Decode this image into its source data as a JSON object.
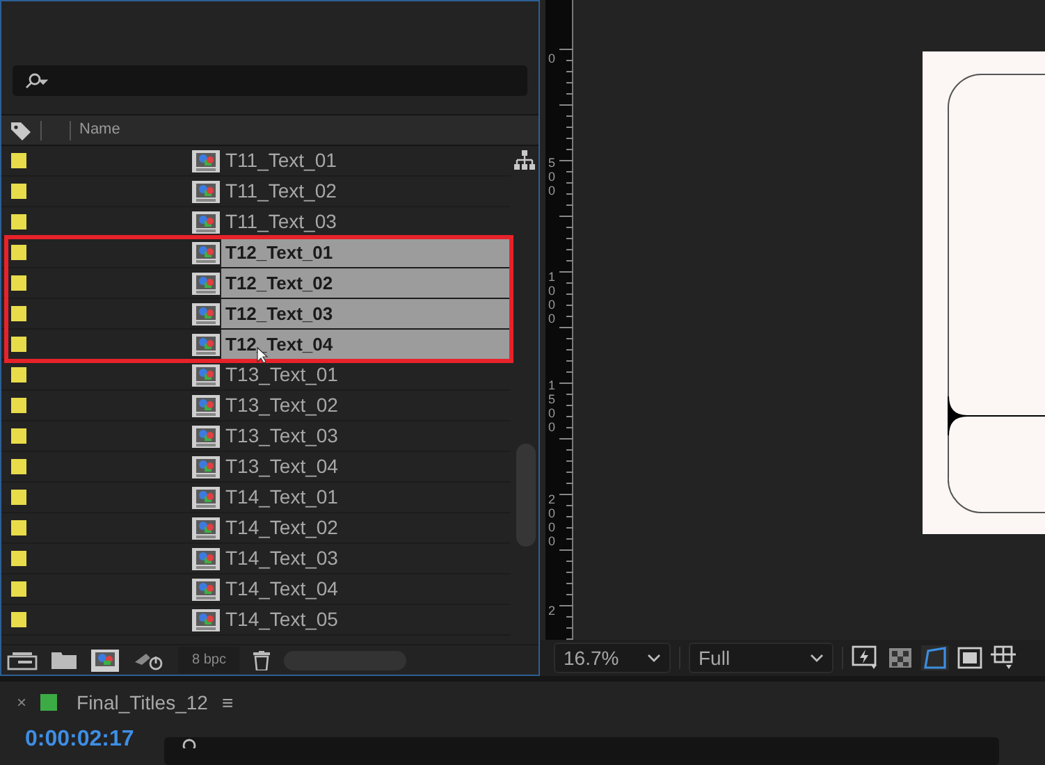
{
  "project_panel": {
    "columns": [
      "Name"
    ],
    "footer": {
      "bit_depth": "8 bpc"
    },
    "items": [
      {
        "name": "T11_Text_01",
        "selected": false
      },
      {
        "name": "T11_Text_02",
        "selected": false
      },
      {
        "name": "T11_Text_03",
        "selected": false
      },
      {
        "name": "T12_Text_01",
        "selected": true
      },
      {
        "name": "T12_Text_02",
        "selected": true
      },
      {
        "name": "T12_Text_03",
        "selected": true
      },
      {
        "name": "T12_Text_04",
        "selected": true
      },
      {
        "name": "T13_Text_01",
        "selected": false
      },
      {
        "name": "T13_Text_02",
        "selected": false
      },
      {
        "name": "T13_Text_03",
        "selected": false
      },
      {
        "name": "T13_Text_04",
        "selected": false
      },
      {
        "name": "T14_Text_01",
        "selected": false
      },
      {
        "name": "T14_Text_02",
        "selected": false
      },
      {
        "name": "T14_Text_03",
        "selected": false
      },
      {
        "name": "T14_Text_04",
        "selected": false
      },
      {
        "name": "T14_Text_05",
        "selected": false
      }
    ]
  },
  "viewer": {
    "ruler_labels": [
      "0",
      "500",
      "1000",
      "1500",
      "2000",
      "2"
    ],
    "zoom": "16.7%",
    "resolution": "Full"
  },
  "timeline": {
    "title": "Final_Titles_12",
    "close": "×",
    "menu": "≡",
    "timecode": "0:00:02:17"
  }
}
